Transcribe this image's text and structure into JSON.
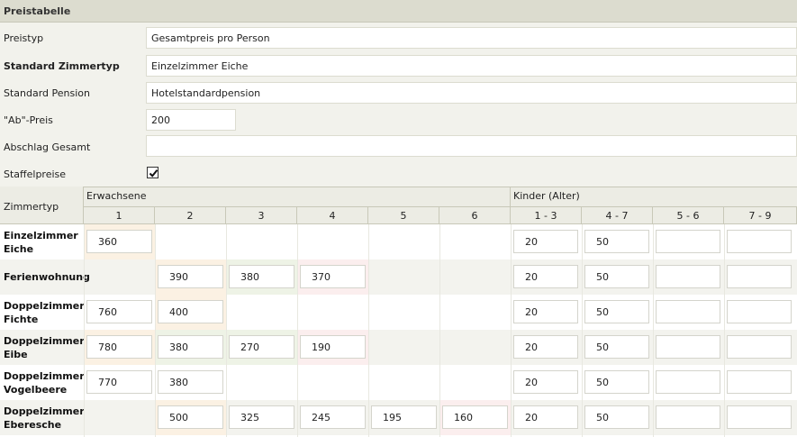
{
  "panel": {
    "title": "Preistabelle"
  },
  "form": {
    "preistyp": {
      "label": "Preistyp",
      "value": "Gesamtpreis pro Person"
    },
    "standard_zimmertyp": {
      "label": "Standard Zimmertyp",
      "value": "Einzelzimmer Eiche"
    },
    "standard_pension": {
      "label": "Standard Pension",
      "value": "Hotelstandardpension"
    },
    "ab_preis": {
      "label": "\"Ab\"-Preis",
      "value": "200"
    },
    "abschlag_gesamt": {
      "label": "Abschlag Gesamt",
      "value": ""
    },
    "staffelpreise": {
      "label": "Staffelpreise",
      "checked": true
    }
  },
  "table": {
    "zimmertyp_header": "Zimmertyp",
    "groups": {
      "erwachsene": "Erwachsene",
      "kinder": "Kinder (Alter)"
    },
    "columns": [
      "1",
      "2",
      "3",
      "4",
      "5",
      "6",
      "1 - 3",
      "4 - 7",
      "5 - 6",
      "7 - 9"
    ],
    "rows": [
      {
        "name": "Einzelzimmer Eiche",
        "cells": [
          "360",
          null,
          null,
          null,
          null,
          null,
          "20",
          "50",
          "",
          ""
        ]
      },
      {
        "name": "Ferienwohnung",
        "cells": [
          null,
          "390",
          "380",
          "370",
          null,
          null,
          "20",
          "50",
          "",
          ""
        ]
      },
      {
        "name": "Doppelzimmer Fichte",
        "cells": [
          "760",
          "400",
          null,
          null,
          null,
          null,
          "20",
          "50",
          "",
          ""
        ]
      },
      {
        "name": "Doppelzimmer Eibe",
        "cells": [
          "780",
          "380",
          "270",
          "190",
          null,
          null,
          "20",
          "50",
          "",
          ""
        ]
      },
      {
        "name": "Doppelzimmer Vogelbeere",
        "cells": [
          "770",
          "380",
          null,
          null,
          null,
          null,
          "20",
          "50",
          "",
          ""
        ]
      },
      {
        "name": "Doppelzimmer Eberesche",
        "cells": [
          null,
          "500",
          "325",
          "245",
          "195",
          "160",
          "20",
          "50",
          "",
          ""
        ]
      }
    ]
  }
}
